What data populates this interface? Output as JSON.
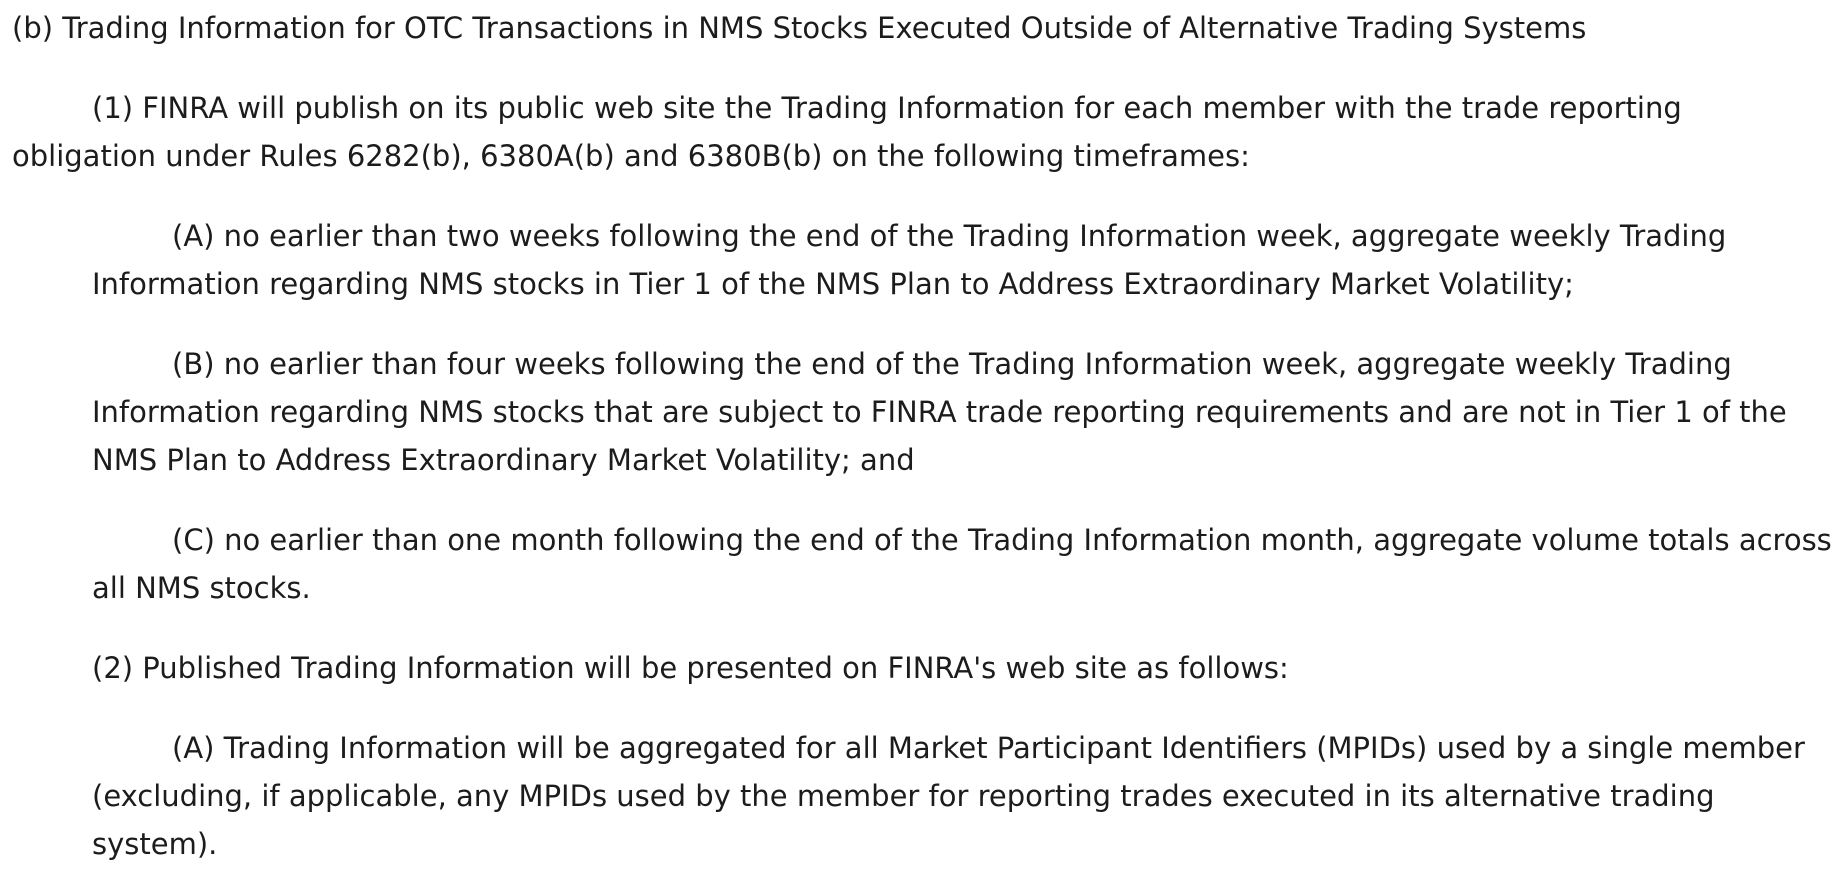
{
  "section": {
    "heading": "(b) Trading Information for OTC Transactions in NMS Stocks Executed Outside of Alternative Trading Systems",
    "para1": "(1) FINRA will publish on its public web site the Trading Information for each member with the trade reporting obligation under Rules 6282(b), 6380A(b) and 6380B(b) on the following timeframes:",
    "para1_items": [
      "(A) no earlier than two weeks following the end of the Trading Information week, aggregate weekly Trading Information regarding NMS stocks in Tier 1 of the NMS Plan to Address Extraordinary Market Volatility;",
      "(B) no earlier than four weeks following the end of the Trading Information week, aggregate weekly Trading Information regarding NMS stocks that are subject to FINRA trade reporting requirements and are not in Tier 1 of the NMS Plan to Address Extraordinary Market Volatility; and",
      "(C) no earlier than one month following the end of the Trading Information month, aggregate volume totals across all NMS stocks."
    ],
    "para2": "(2) Published Trading Information will be presented on FINRA's web site as follows:",
    "para2_items": [
      "(A) Trading Information will be aggregated for all Market Participant Identifiers (MPIDs) used by a single member (excluding, if applicable, any MPIDs used by the member for reporting trades executed in its alternative trading system)."
    ]
  }
}
